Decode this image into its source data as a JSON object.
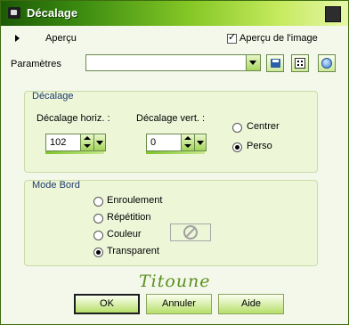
{
  "window": {
    "title": "Décalage"
  },
  "preview": {
    "label": "Aperçu",
    "image_preview_label": "Aperçu de l'image",
    "image_preview_checked": true
  },
  "params": {
    "label": "Paramètres",
    "value": ""
  },
  "offset_group": {
    "title": "Décalage",
    "horiz_label": "Décalage horiz. :",
    "vert_label": "Décalage vert. :",
    "horiz_value": "102",
    "vert_value": "0",
    "center_label": "Centrer",
    "custom_label": "Perso",
    "selected": "Perso"
  },
  "edge_group": {
    "title": "Mode Bord",
    "options": [
      "Enroulement",
      "Répétition",
      "Couleur",
      "Transparent"
    ],
    "selected": "Transparent"
  },
  "signature": "Titoune",
  "buttons": {
    "ok": "OK",
    "cancel": "Annuler",
    "help": "Aide"
  },
  "colors": {
    "title_dark": "#1c5a06",
    "title_light": "#e6f7a8",
    "background": "#f4f8ea"
  },
  "icons": [
    "settings-window-icon",
    "close-icon",
    "expand-arrow-icon",
    "save-icon",
    "randomize-dice-icon",
    "reset-icon",
    "no-color-icon"
  ]
}
